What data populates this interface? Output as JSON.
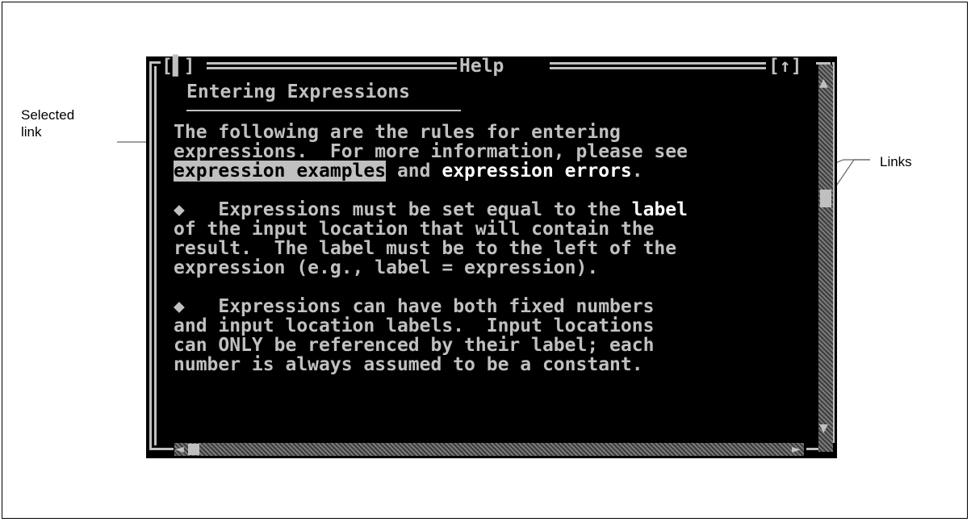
{
  "callouts": {
    "selected_link": "Selected\nlink",
    "links": "Links"
  },
  "window": {
    "title": "Help",
    "close_button": "[▌]",
    "zoom_button": "[↑]",
    "heading": "Entering Expressions",
    "intro_line1": "The following are the rules for entering",
    "intro_line2": "expressions.  For more information, please see",
    "link_examples": "expression examples",
    "and_text": " and ",
    "link_errors": "expression errors",
    "period": ".",
    "bullet": "◆",
    "p1_line1": "   Expressions must be set equal to the ",
    "link_label": "label",
    "p1_line2": "of the input location that will contain the",
    "p1_line3": "result.  The label must be to the left of the",
    "p1_line4": "expression (e.g., label = expression).",
    "p2_line1": "   Expressions can have both fixed numbers",
    "p2_line2": "and input location labels.  Input locations",
    "p2_line3": "can ONLY be referenced by their label; each",
    "p2_line4": "number is always assumed to be a constant."
  },
  "colors": {
    "background": "#000000",
    "text": "#c0c0c0",
    "link": "#ffffff",
    "selected_bg": "#c0c0c0"
  }
}
